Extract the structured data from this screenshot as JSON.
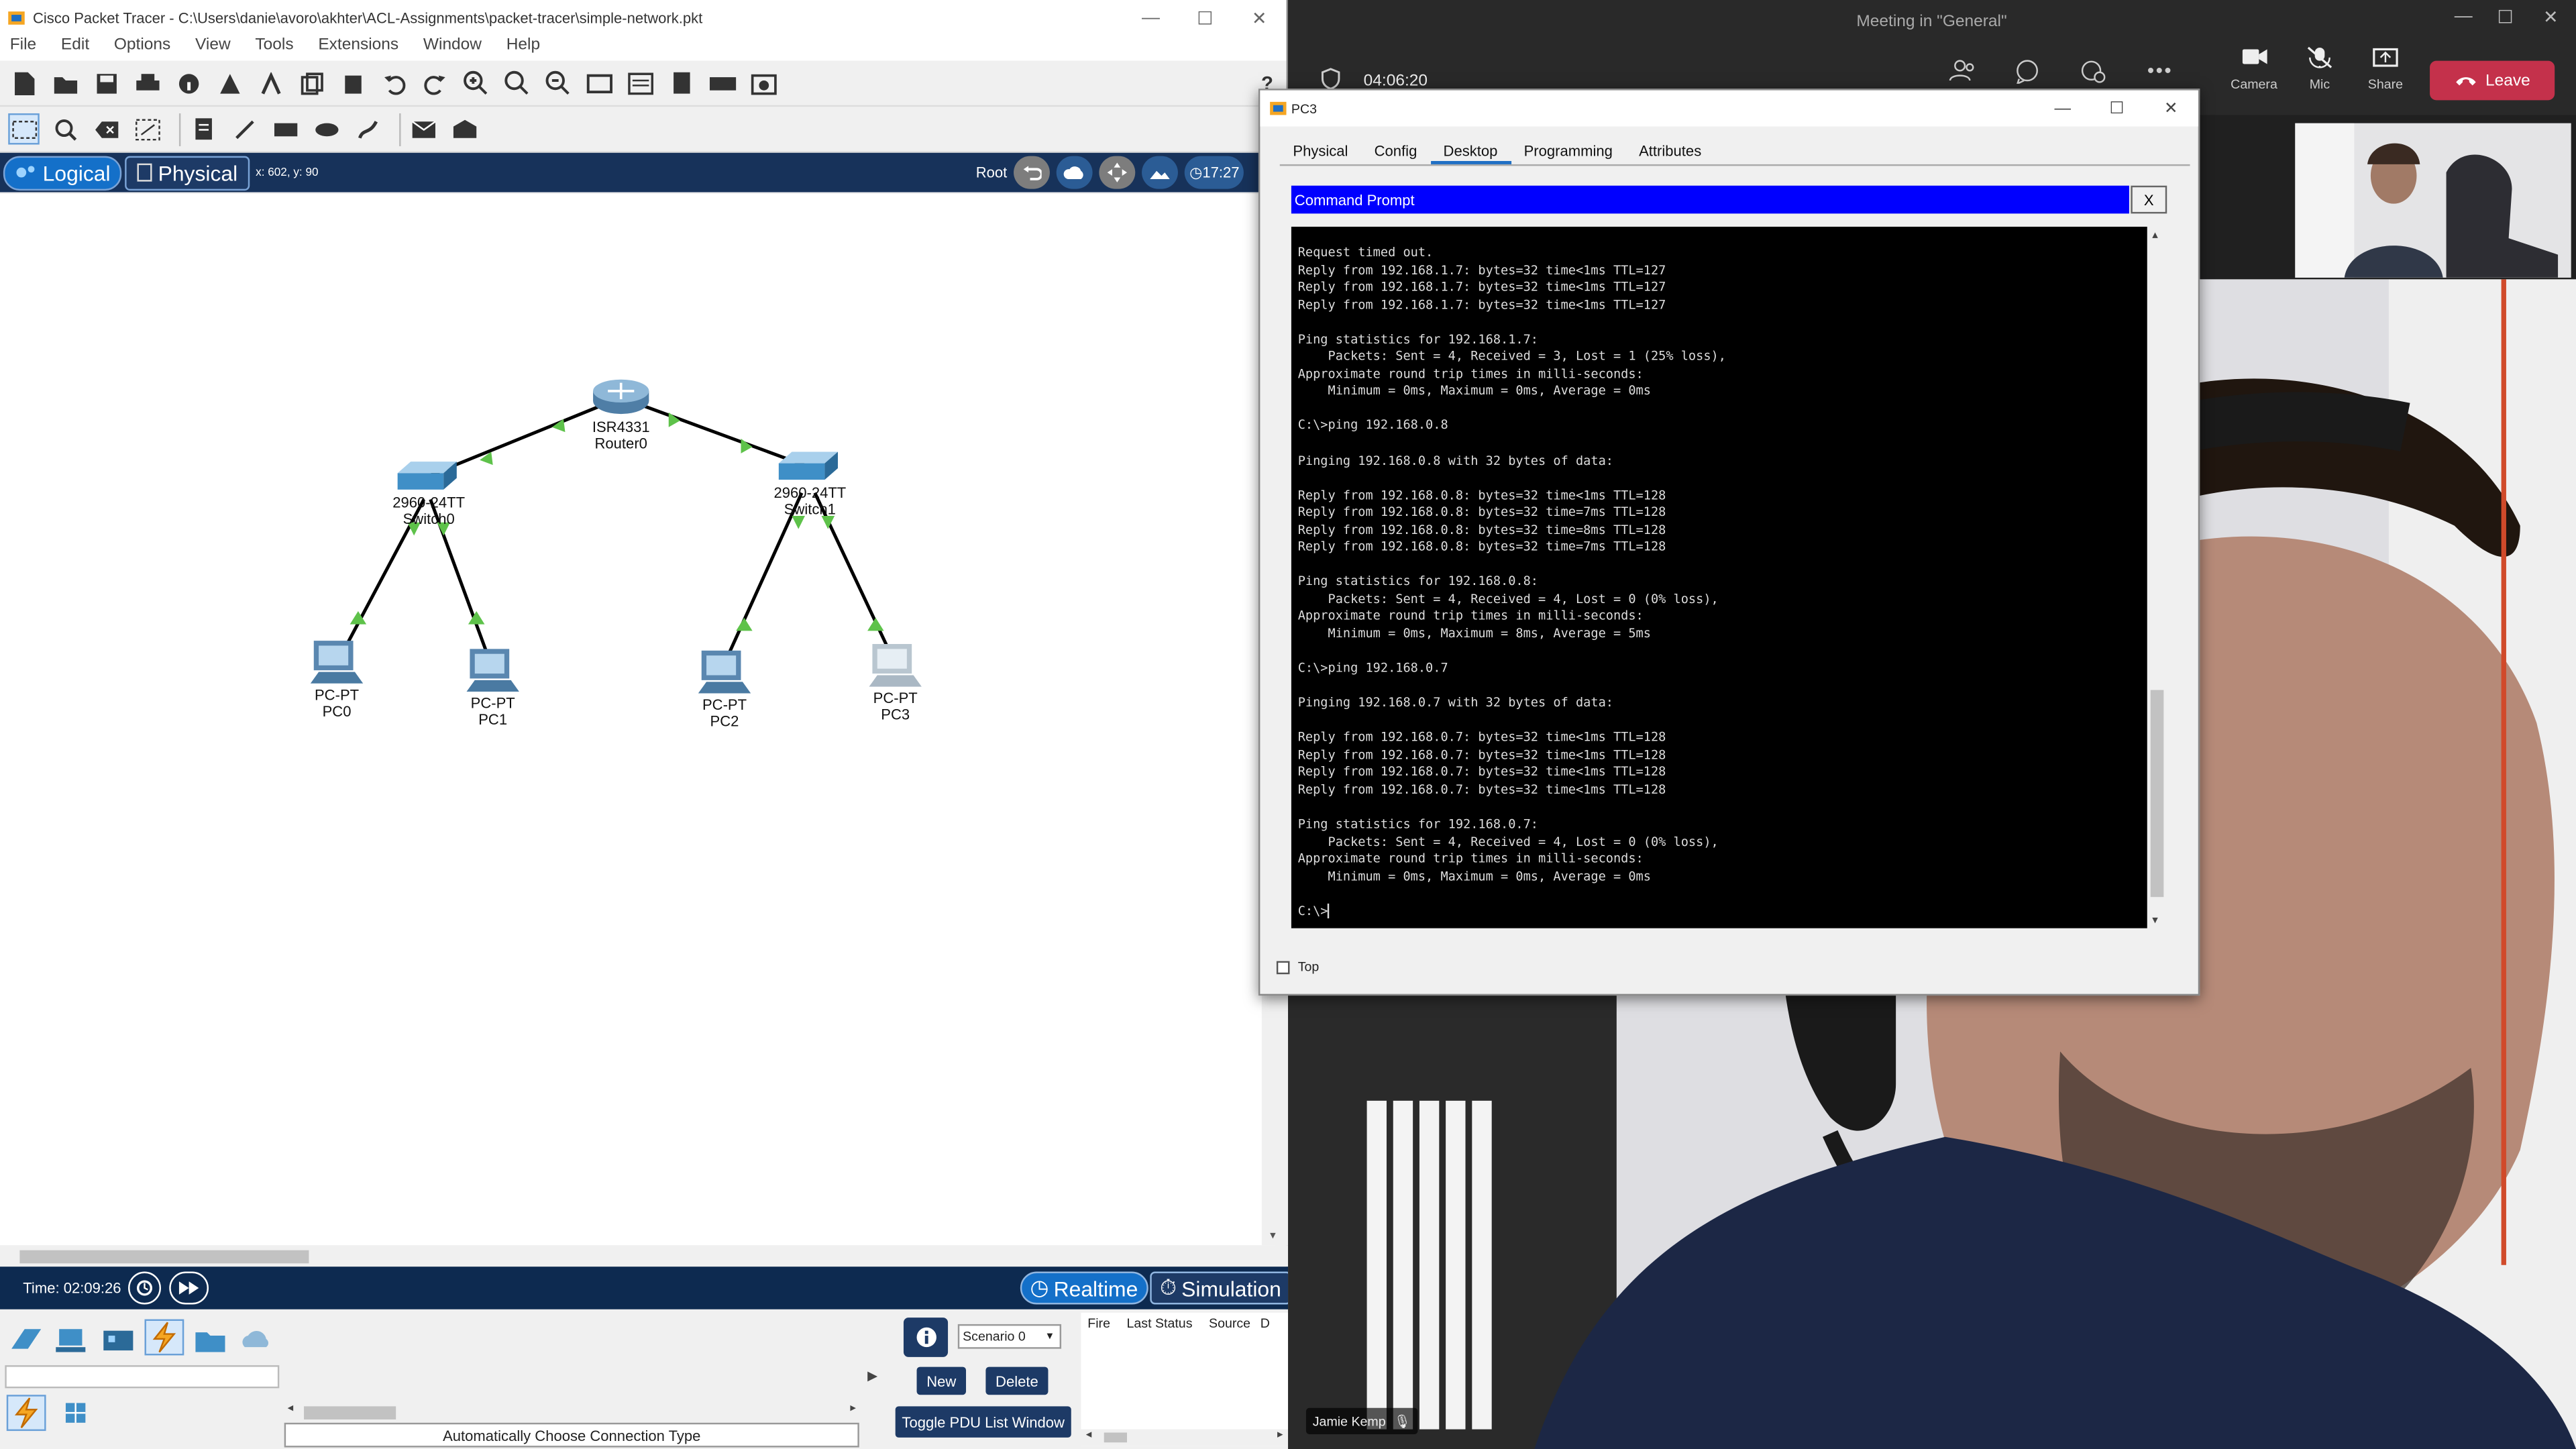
{
  "packet_tracer": {
    "title": "Cisco Packet Tracer - C:\\Users\\danie\\avoro\\akhter\\ACL-Assignments\\packet-tracer\\simple-network.pkt",
    "menu": [
      "File",
      "Edit",
      "Options",
      "View",
      "Tools",
      "Extensions",
      "Window",
      "Help"
    ],
    "help_glyph": "?",
    "tabs": {
      "logical": "Logical",
      "physical": "Physical"
    },
    "coords": "x: 602, y: 90",
    "root_label": "Root",
    "clock": "17:27",
    "time_label": "Time: 02:09:26",
    "modes": {
      "realtime": "Realtime",
      "simulation": "Simulation"
    },
    "connection_type": "Automatically Choose Connection Type",
    "scenario": "Scenario 0",
    "pdu": {
      "new": "New",
      "delete": "Delete",
      "toggle": "Toggle PDU List Window"
    },
    "pdu_columns": [
      "Fire",
      "Last Status",
      "Source",
      "D"
    ],
    "devices": [
      {
        "id": "router0",
        "model": "ISR4331",
        "name": "Router0"
      },
      {
        "id": "switch0",
        "model": "2960-24TT",
        "name": "Switch0"
      },
      {
        "id": "switch1",
        "model": "2960-24TT",
        "name": "Switch1"
      },
      {
        "id": "pc0",
        "model": "PC-PT",
        "name": "PC0"
      },
      {
        "id": "pc1",
        "model": "PC-PT",
        "name": "PC1"
      },
      {
        "id": "pc2",
        "model": "PC-PT",
        "name": "PC2"
      },
      {
        "id": "pc3",
        "model": "PC-PT",
        "name": "PC3"
      }
    ]
  },
  "teams": {
    "meeting_title": "Meeting in \"General\"",
    "elapsed": "04:06:20",
    "controls": {
      "camera": "Camera",
      "mic": "Mic",
      "share": "Share",
      "leave": "Leave"
    },
    "participant": "Jamie Kemp"
  },
  "pc3_window": {
    "title": "PC3",
    "tabs": [
      "Physical",
      "Config",
      "Desktop",
      "Programming",
      "Attributes"
    ],
    "active_tab": "Desktop",
    "command_prompt_title": "Command Prompt",
    "close_label": "X",
    "top_checkbox": "Top",
    "console_lines": [
      "Request timed out.",
      "Reply from 192.168.1.7: bytes=32 time<1ms TTL=127",
      "Reply from 192.168.1.7: bytes=32 time<1ms TTL=127",
      "Reply from 192.168.1.7: bytes=32 time<1ms TTL=127",
      "",
      "Ping statistics for 192.168.1.7:",
      "    Packets: Sent = 4, Received = 3, Lost = 1 (25% loss),",
      "Approximate round trip times in milli-seconds:",
      "    Minimum = 0ms, Maximum = 0ms, Average = 0ms",
      "",
      "C:\\>ping 192.168.0.8",
      "",
      "Pinging 192.168.0.8 with 32 bytes of data:",
      "",
      "Reply from 192.168.0.8: bytes=32 time<1ms TTL=128",
      "Reply from 192.168.0.8: bytes=32 time=7ms TTL=128",
      "Reply from 192.168.0.8: bytes=32 time=8ms TTL=128",
      "Reply from 192.168.0.8: bytes=32 time=7ms TTL=128",
      "",
      "Ping statistics for 192.168.0.8:",
      "    Packets: Sent = 4, Received = 4, Lost = 0 (0% loss),",
      "Approximate round trip times in milli-seconds:",
      "    Minimum = 0ms, Maximum = 8ms, Average = 5ms",
      "",
      "C:\\>ping 192.168.0.7",
      "",
      "Pinging 192.168.0.7 with 32 bytes of data:",
      "",
      "Reply from 192.168.0.7: bytes=32 time<1ms TTL=128",
      "Reply from 192.168.0.7: bytes=32 time<1ms TTL=128",
      "Reply from 192.168.0.7: bytes=32 time<1ms TTL=128",
      "Reply from 192.168.0.7: bytes=32 time<1ms TTL=128",
      "",
      "Ping statistics for 192.168.0.7:",
      "    Packets: Sent = 4, Received = 4, Lost = 0 (0% loss),",
      "Approximate round trip times in milli-seconds:",
      "    Minimum = 0ms, Maximum = 0ms, Average = 0ms",
      "",
      "C:\\>"
    ]
  },
  "colors": {
    "pt_blue": "#17325a",
    "pt_accent": "#1470c9",
    "cmd_title": "#0000ff",
    "leave": "#c4314b",
    "link_green": "#5ec24a"
  }
}
